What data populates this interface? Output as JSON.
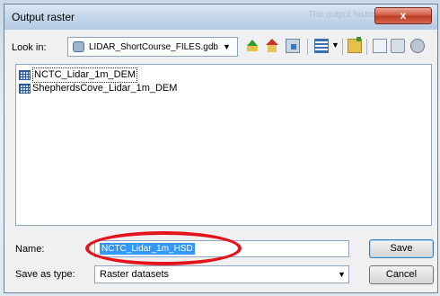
{
  "window": {
    "title": "Output raster",
    "background_text": "The output history and",
    "close_glyph": "x"
  },
  "toolbar": {
    "lookin_label": "Look in:",
    "lookin_value": "LIDAR_ShortCourse_FILES.gdb",
    "dropdown_glyph": "▼",
    "icons": [
      "up-one-level-icon",
      "home-icon",
      "connect-folder-icon",
      "view-icon",
      "new-folder-icon",
      "catalog-icon",
      "file-icon",
      "disconnect-icon"
    ]
  },
  "files": [
    {
      "name": "NCTC_Lidar_1m_DEM",
      "icon": "raster-dataset-icon"
    },
    {
      "name": "ShepherdsCove_Lidar_1m_DEM",
      "icon": "raster-dataset-icon"
    }
  ],
  "form": {
    "name_label": "Name:",
    "name_value": "NCTC_Lidar_1m_HSD",
    "saveas_label": "Save as type:",
    "saveas_value": "Raster datasets"
  },
  "buttons": {
    "save": "Save",
    "cancel": "Cancel"
  },
  "annotation": {
    "highlight_color": "#e3141d"
  }
}
